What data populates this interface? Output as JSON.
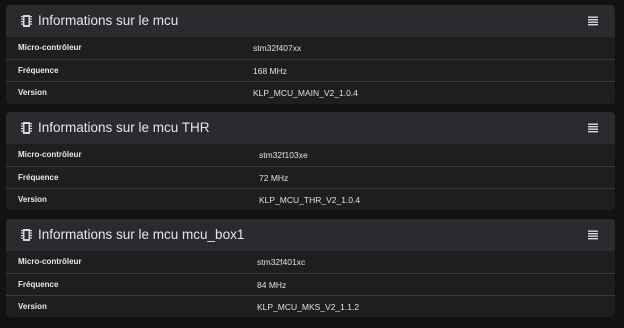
{
  "panels": [
    {
      "title": "Informations sur le mcu",
      "rows": [
        {
          "label": "Micro-contrôleur",
          "value": "stm32f407xx"
        },
        {
          "label": "Fréquence",
          "value": "168 MHz"
        },
        {
          "label": "Version",
          "value": "KLP_MCU_MAIN_V2_1.0.4"
        }
      ]
    },
    {
      "title": "Informations sur le mcu THR",
      "rows": [
        {
          "label": "Micro-contrôleur",
          "value": "stm32f103xe"
        },
        {
          "label": "Fréquence",
          "value": "72 MHz"
        },
        {
          "label": "Version",
          "value": "KLP_MCU_THR_V2_1.0.4"
        }
      ]
    },
    {
      "title": "Informations sur le mcu mcu_box1",
      "rows": [
        {
          "label": "Micro-contrôleur",
          "value": "stm32f401xc"
        },
        {
          "label": "Fréquence",
          "value": "84 MHz"
        },
        {
          "label": "Version",
          "value": "KLP_MCU_MKS_V2_1.1.2"
        }
      ]
    }
  ],
  "icons": {
    "panel_icon": "chip-icon",
    "menu_icon": "menu-icon"
  }
}
